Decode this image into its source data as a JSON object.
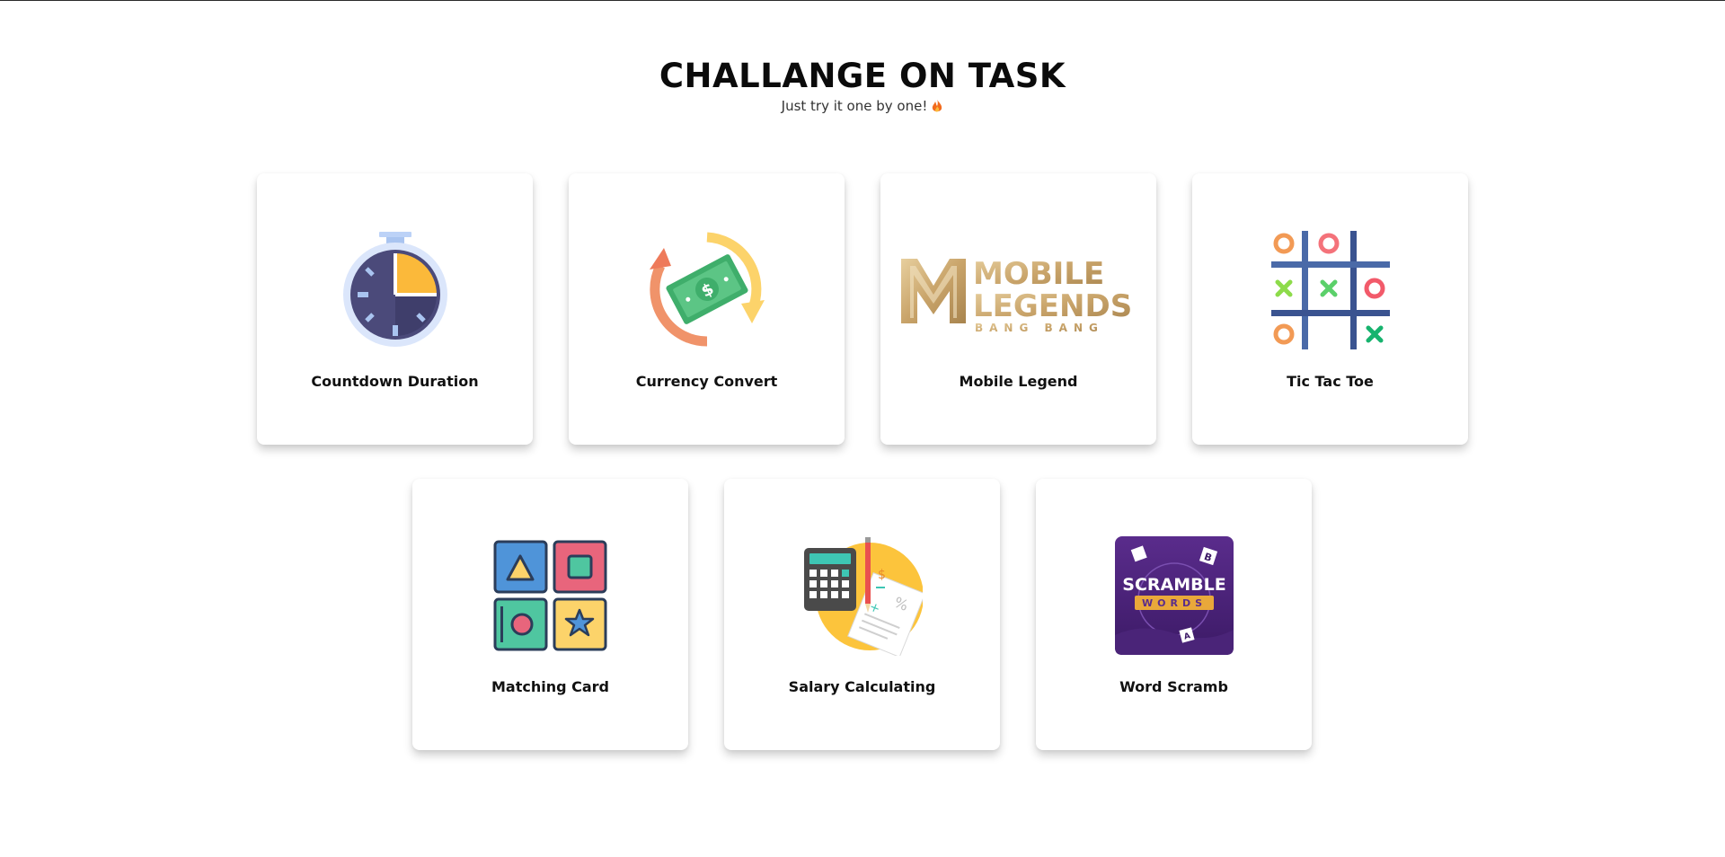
{
  "header": {
    "title": "CHALLANGE ON TASK",
    "subtitle": "Just try it one by one!"
  },
  "cards": [
    {
      "label": "Countdown Duration",
      "icon": "stopwatch-icon"
    },
    {
      "label": "Currency Convert",
      "icon": "currency-exchange-icon"
    },
    {
      "label": "Mobile Legend",
      "icon": "mobile-legends-logo",
      "logo_text": [
        "MOBILE",
        "LEGENDS",
        "BANG BANG"
      ]
    },
    {
      "label": "Tic Tac Toe",
      "icon": "tic-tac-toe-icon"
    },
    {
      "label": "Matching Card",
      "icon": "shape-cards-icon"
    },
    {
      "label": "Salary Calculating",
      "icon": "calculator-icon"
    },
    {
      "label": "Word Scramb",
      "icon": "scramble-words-icon",
      "logo_text": [
        "SCRAMBLE",
        "WORDS"
      ]
    }
  ],
  "colors": {
    "accent_gold": "#c9a46a",
    "green_cash": "#3fae6b",
    "dial_dark": "#4b4a7a",
    "amber": "#fbb93a"
  }
}
